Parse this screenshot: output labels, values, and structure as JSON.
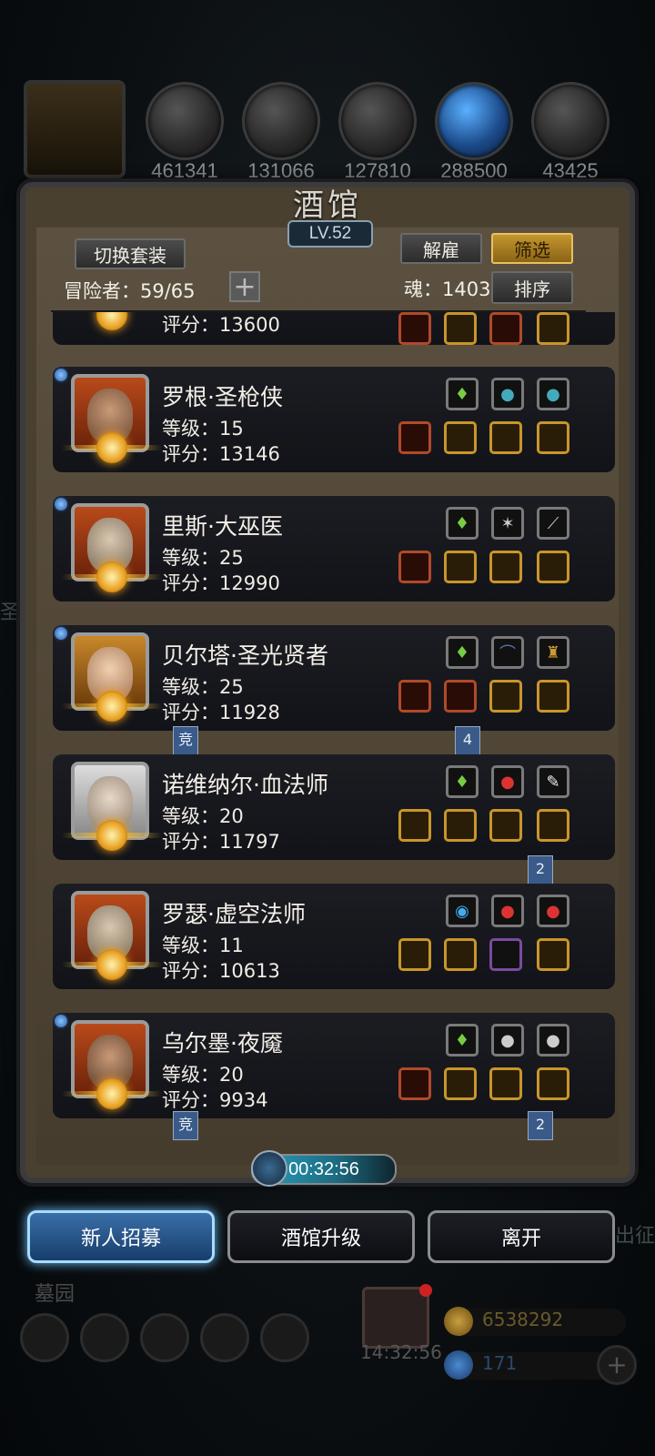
{
  "top_resources": [
    {
      "name": "meat-icon",
      "count": "461341"
    },
    {
      "name": "wood-icon",
      "count": "131066"
    },
    {
      "name": "iron-icon",
      "count": "127810"
    },
    {
      "name": "crystal-icon",
      "count": "288500"
    },
    {
      "name": "stone-icon",
      "count": "43425"
    }
  ],
  "tavern": {
    "title": "酒馆",
    "level": "LV.52",
    "switch_outfit": "切换套装",
    "dismiss": "解雇",
    "filter": "筛选",
    "sort": "排序",
    "adventurer_label": "冒险者：59/65",
    "soul_label": "魂：1403"
  },
  "heroes": [
    {
      "name": "",
      "level": "",
      "score": "评分：13600"
    },
    {
      "name": "罗根·圣枪侠",
      "level": "等级：15",
      "score": "评分：13146"
    },
    {
      "name": "里斯·大巫医",
      "level": "等级：25",
      "score": "评分：12990"
    },
    {
      "name": "贝尔塔·圣光贤者",
      "level": "等级：25",
      "score": "评分：11928",
      "flag_left": "竞",
      "flag_right": "4"
    },
    {
      "name": "诺维纳尔·血法师",
      "level": "等级：20",
      "score": "评分：11797",
      "flag_right": "2"
    },
    {
      "name": "罗瑟·虚空法师",
      "level": "等级：11",
      "score": "评分：10613"
    },
    {
      "name": "乌尔墨·夜魇",
      "level": "等级：20",
      "score": "评分：9934",
      "flag_left": "竞",
      "flag_right": "2"
    }
  ],
  "timer": "00:32:56",
  "actions": {
    "recruit": "新人招募",
    "upgrade": "酒馆升级",
    "leave": "离开"
  },
  "background": {
    "graveyard": "墓园",
    "clock": "14:32:56",
    "gold": "6538292",
    "gems": "171",
    "left_edge": "圣",
    "right_edge": "出征"
  }
}
